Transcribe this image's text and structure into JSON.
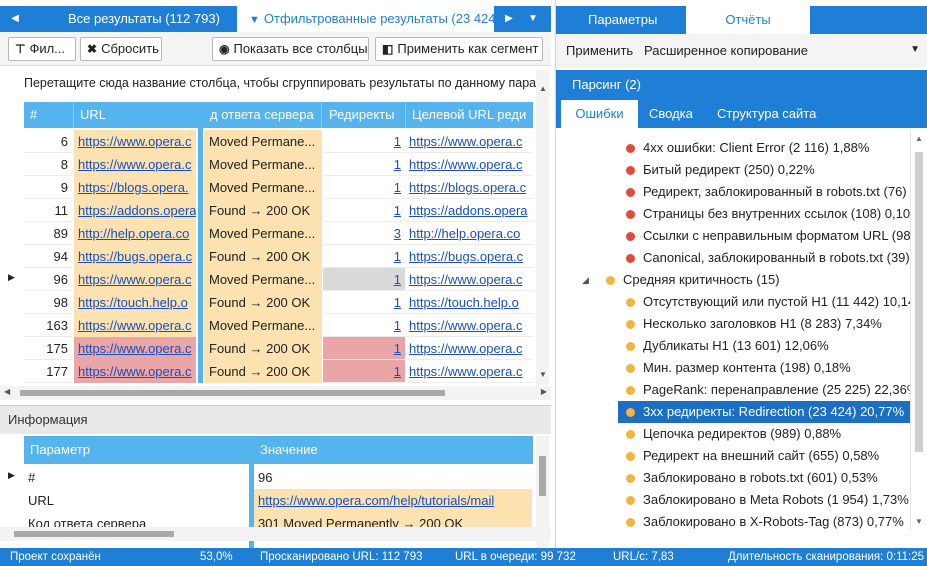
{
  "left_tabs": {
    "all": "Все результаты (112 793)",
    "filtered": "Отфильтрованные результаты (23 424)"
  },
  "toolbar": {
    "filter": "Фил...",
    "reset": "Сбросить",
    "show_columns": "Показать все столбцы",
    "apply_segment": "Применить как сегмент"
  },
  "group_hint": "Перетащите сюда название столбца, чтобы сгруппировать результаты по данному парамет",
  "grid": {
    "columns": [
      "#",
      "URL",
      "д ответа сервера",
      "Редиректы",
      "Целевой URL реди"
    ],
    "rows": [
      {
        "num": "6",
        "url": "https://www.opera.c",
        "code": "Moved Permane...",
        "redir": "1",
        "target": "https://www.opera.c"
      },
      {
        "num": "8",
        "url": "https://www.opera.c",
        "code": "Moved Permane...",
        "redir": "1",
        "target": "https://www.opera.c"
      },
      {
        "num": "9",
        "url": "https://blogs.opera.",
        "code": "Moved Permane...",
        "redir": "1",
        "target": "https://blogs.opera.c"
      },
      {
        "num": "11",
        "url": "https://addons.opera",
        "code": "Found → 200 OK",
        "redir": "1",
        "target": "https://addons.opera"
      },
      {
        "num": "89",
        "url": "http://help.opera.co",
        "code": "Moved Permane...",
        "redir": "3",
        "target": "http://help.opera.co"
      },
      {
        "num": "94",
        "url": "https://bugs.opera.c",
        "code": "Found → 200 OK",
        "redir": "1",
        "target": "https://bugs.opera.c"
      },
      {
        "num": "96",
        "url": "https://www.opera.c",
        "code": "Moved Permane...",
        "redir": "1",
        "target": "https://www.opera.c"
      },
      {
        "num": "98",
        "url": "https://touch.help.o",
        "code": "Found → 200 OK",
        "redir": "1",
        "target": "https://touch.help.o"
      },
      {
        "num": "163",
        "url": "https://www.opera.c",
        "code": "Moved Permane...",
        "redir": "1",
        "target": "https://www.opera.c"
      },
      {
        "num": "175",
        "url": "https://www.opera.c",
        "code": "Found → 200 OK",
        "redir": "1",
        "target": "https://www.opera.c"
      },
      {
        "num": "177",
        "url": "https://www.opera.c",
        "code": "Found → 200 OK",
        "redir": "1",
        "target": "https://www.opera.c"
      }
    ]
  },
  "info": {
    "title": "Информация",
    "col_param": "Параметр",
    "col_value": "Значение",
    "rows": [
      {
        "param": "#",
        "value": "96"
      },
      {
        "param": "URL",
        "value": "https://www.opera.com/help/tutorials/mail"
      },
      {
        "param": "Код ответа сервера",
        "value": "301 Moved Permanently → 200 OK"
      }
    ]
  },
  "right_tabs": {
    "params": "Параметры",
    "reports": "Отчёты"
  },
  "right_menu": {
    "apply": "Применить",
    "extended_copy": "Расширенное копирование"
  },
  "parsing": "Парсинг (2)",
  "sub_tabs": [
    "Ошибки",
    "Сводка",
    "Структура сайта"
  ],
  "tree": [
    {
      "label": "4xx ошибки: Client Error (2 116) 1,88%",
      "color": "#e04b3c"
    },
    {
      "label": "Битый редирект (250) 0,22%",
      "color": "#e04b3c"
    },
    {
      "label": "Редирект, заблокированный в robots.txt (76)",
      "color": "#e04b3c"
    },
    {
      "label": "Страницы без внутренних ссылок (108) 0,10%",
      "color": "#e04b3c"
    },
    {
      "label": "Ссылки с неправильным форматом URL (98)",
      "color": "#e04b3c"
    },
    {
      "label": "Canonical, заблокированный в robots.txt (39)",
      "color": "#e04b3c"
    },
    {
      "label": "Средняя критичность (15)",
      "color": "#f2b53c"
    },
    {
      "label": "Отсутствующий или пустой H1 (11 442) 10,14",
      "color": "#f2b53c"
    },
    {
      "label": "Несколько заголовков H1 (8 283) 7,34%",
      "color": "#f2b53c"
    },
    {
      "label": "Дубликаты H1 (13 601) 12,06%",
      "color": "#f2b53c"
    },
    {
      "label": "Мин. размер контента (198) 0,18%",
      "color": "#f2b53c"
    },
    {
      "label": "PageRank: перенаправление (25 225) 22,36%",
      "color": "#f2b53c"
    },
    {
      "label": "3xx редиректы: Redirection (23 424) 20,77%",
      "color": "#f2b53c"
    },
    {
      "label": "Цепочка редиректов (989) 0,88%",
      "color": "#f2b53c"
    },
    {
      "label": "Редирект на внешний сайт (655) 0,58%",
      "color": "#f2b53c"
    },
    {
      "label": "Заблокировано в robots.txt (601) 0,53%",
      "color": "#f2b53c"
    },
    {
      "label": "Заблокировано в Meta Robots (1 954) 1,73%",
      "color": "#f2b53c"
    },
    {
      "label": "Заблокировано в X-Robots-Tag (873) 0,77%",
      "color": "#f2b53c"
    }
  ],
  "status": {
    "saved": "Проект сохранён",
    "percent": "53,0%",
    "scanned": "Просканировано URL: 112 793",
    "queue": "URL в очереди: 99 732",
    "rate": "URL/с: 7,83",
    "duration": "Длительность сканирования: 0:11:25"
  }
}
